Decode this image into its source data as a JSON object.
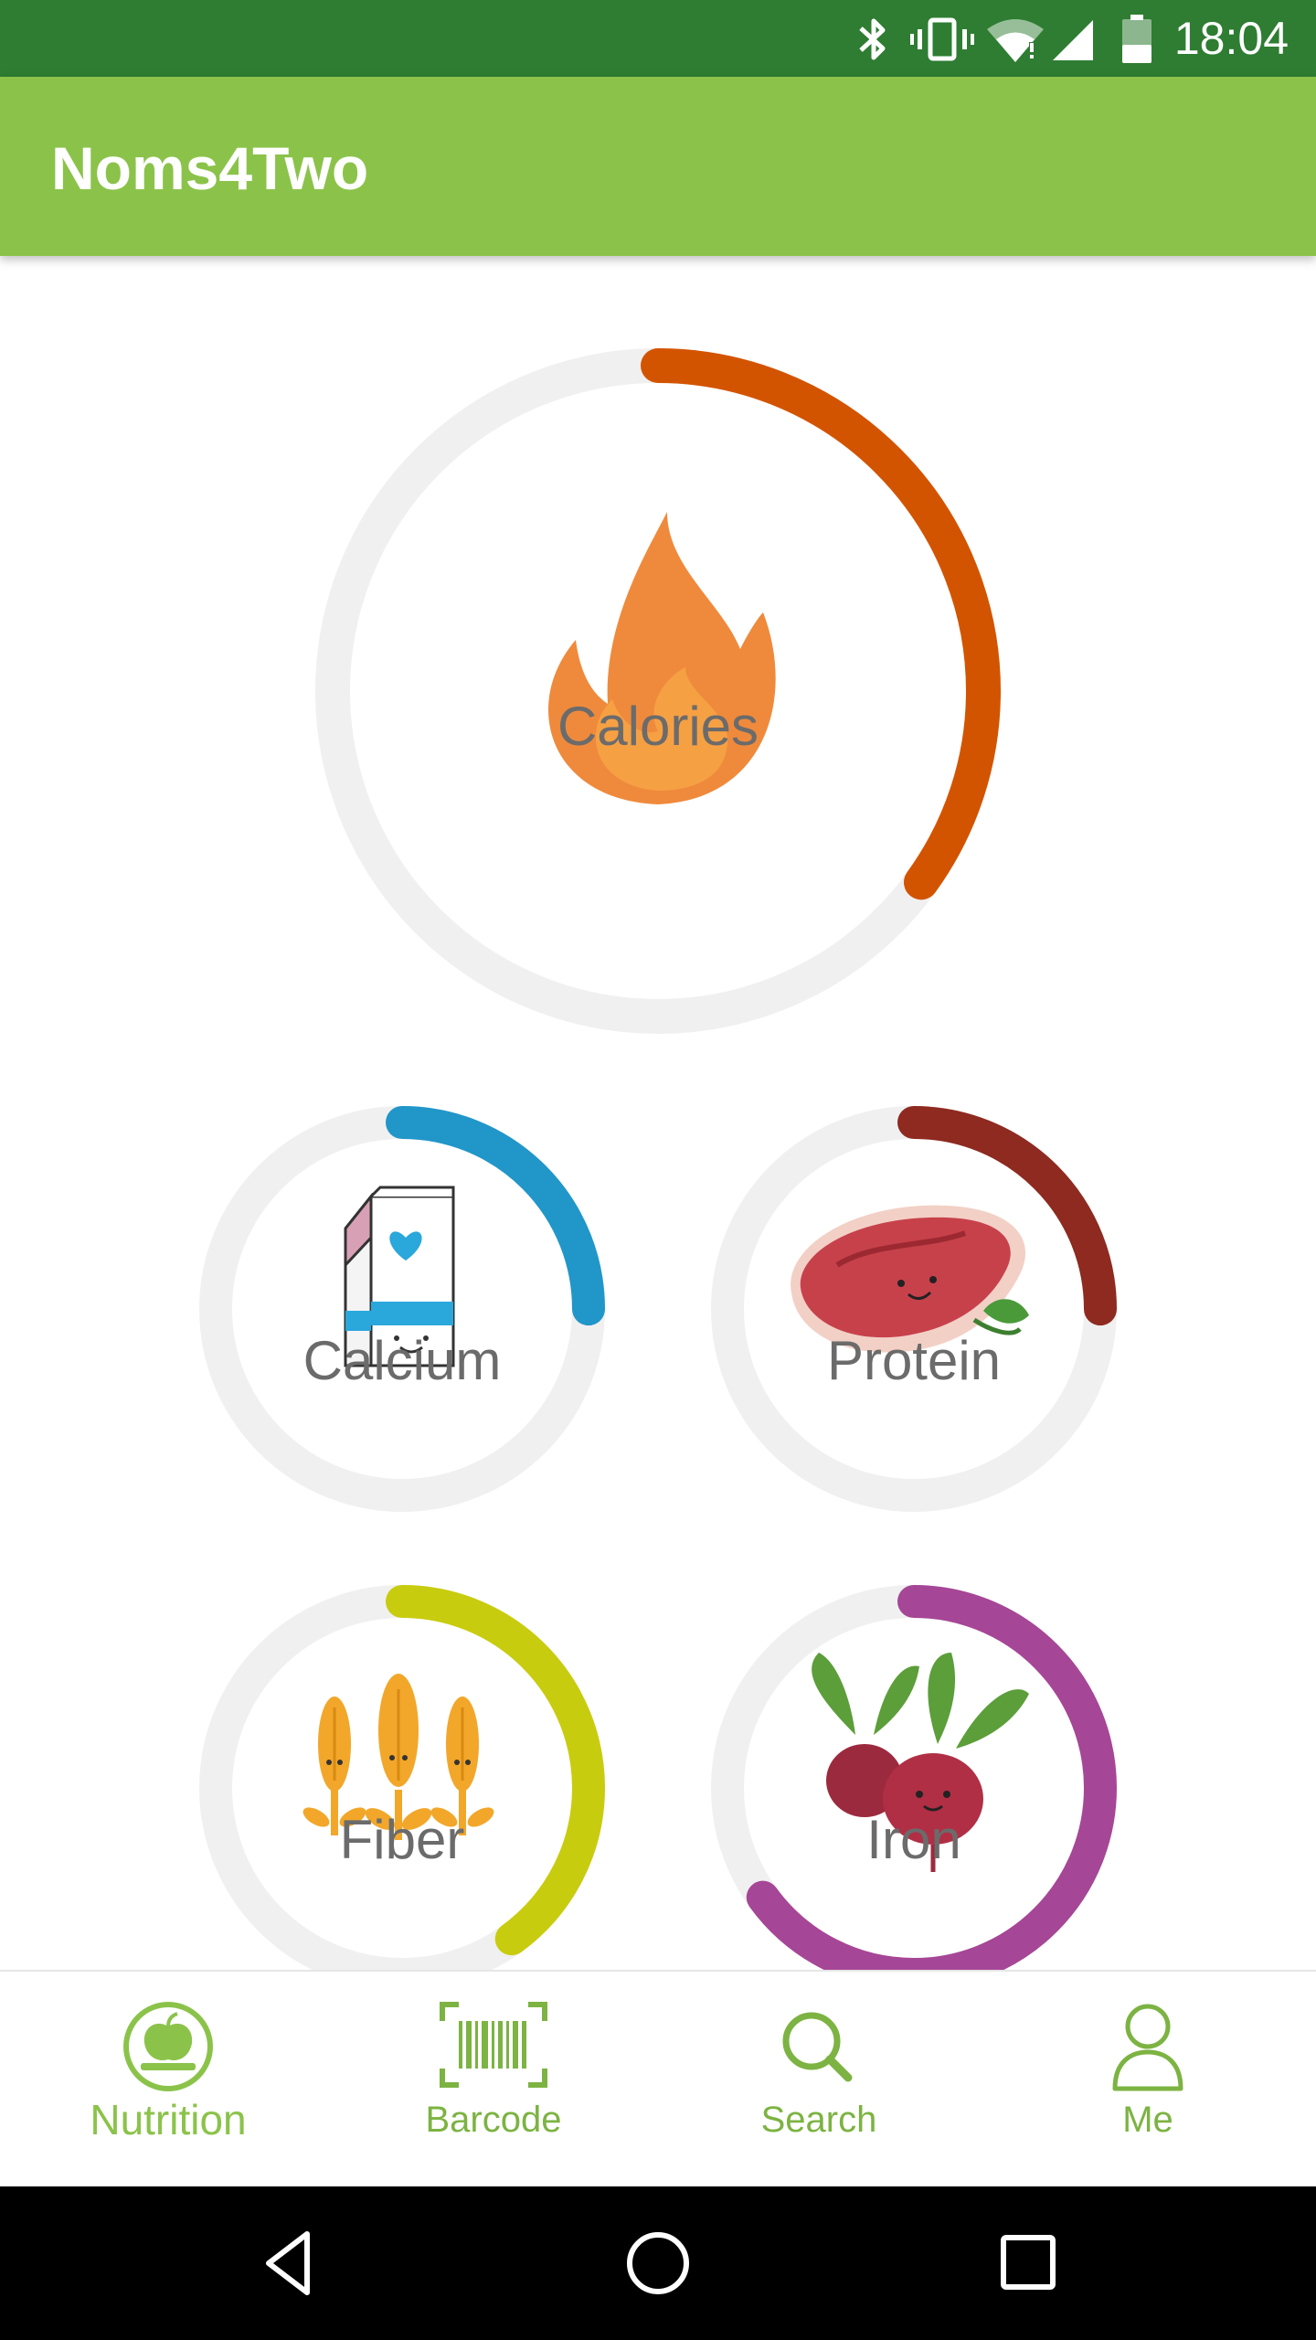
{
  "status_bar": {
    "time": "18:04",
    "icons": [
      "bluetooth-icon",
      "vibrate-icon",
      "wifi-icon",
      "cell-signal-icon",
      "battery-icon"
    ]
  },
  "app_bar": {
    "title": "Noms4Two"
  },
  "rings": {
    "calories": {
      "label": "Calories",
      "progress": 0.35,
      "color": "#d35400",
      "icon": "flame-icon"
    },
    "calcium": {
      "label": "Calcium",
      "progress": 0.25,
      "color": "#2196c9",
      "icon": "milk-carton-icon"
    },
    "protein": {
      "label": "Protein",
      "progress": 0.25,
      "color": "#8e2a20",
      "icon": "steak-icon"
    },
    "fiber": {
      "label": "Fiber",
      "progress": 0.4,
      "color": "#c8cc0e",
      "icon": "wheat-icon"
    },
    "iron": {
      "label": "Iron",
      "progress": 0.65,
      "color": "#a64696",
      "icon": "beets-icon"
    }
  },
  "bottom_nav": {
    "items": [
      {
        "label": "Nutrition",
        "icon": "apple-scale-icon",
        "active": true
      },
      {
        "label": "Barcode",
        "icon": "barcode-icon",
        "active": false
      },
      {
        "label": "Search",
        "icon": "search-icon",
        "active": false
      },
      {
        "label": "Me",
        "icon": "person-icon",
        "active": false
      }
    ]
  },
  "system_nav": {
    "icons": [
      "back-icon",
      "home-icon",
      "recents-icon"
    ]
  },
  "colors": {
    "status_bar": "#2e7d32",
    "app_bar": "#8bc34a",
    "nav_accent": "#7cb342",
    "track": "#f0f0f0"
  }
}
